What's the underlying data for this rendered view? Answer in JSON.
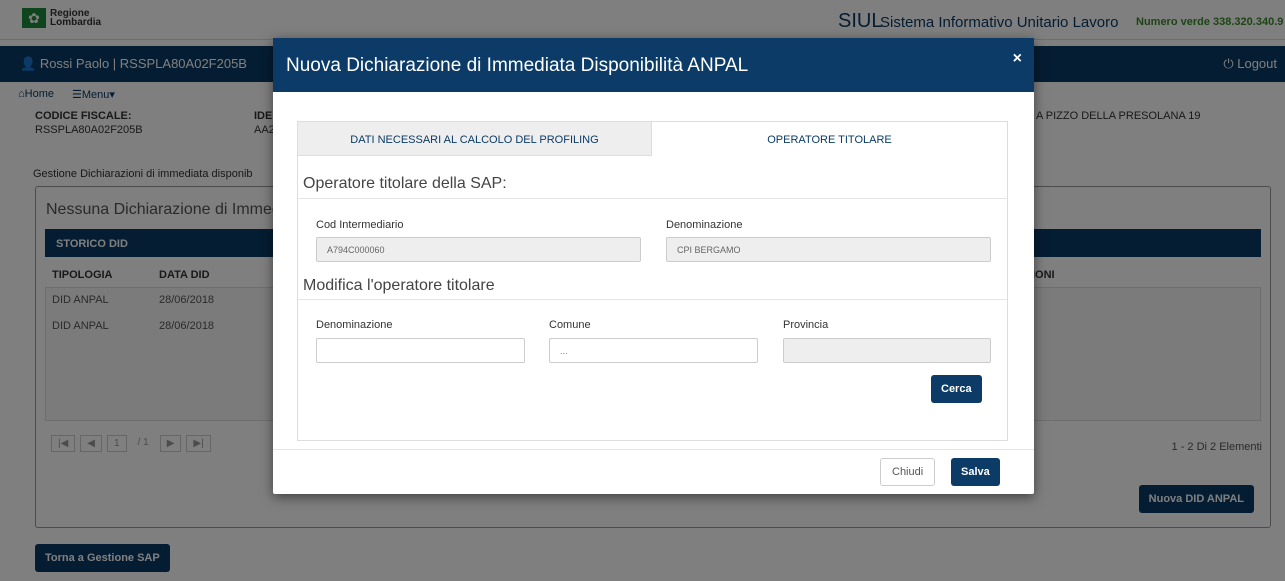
{
  "brand": {
    "logo_line1": "Regione",
    "logo_line2": "Lombardia",
    "siul": "SIUL",
    "siul_sub": "Sistema Informativo Unitario Lavoro",
    "numero_verde": "Numero verde 338.320.340.9"
  },
  "userbar": {
    "user": "Rossi Paolo | RSSPLA80A02F205B",
    "logout": "Logout"
  },
  "nav": {
    "home": "Home",
    "menu": "Menu"
  },
  "anagrafica": {
    "cf_label": "CODICE FISCALE:",
    "cf_value": "RSSPLA80A02F205B",
    "ide_label": "IDE",
    "ide_value": "AA2",
    "address": "A PIZZO DELLA PRESOLANA 19"
  },
  "page": {
    "gestione": "Gestione Dichiarazioni di immediata disponib",
    "panel_title": "Nessuna Dichiarazione di Immedi",
    "storico": "STORICO DID"
  },
  "table": {
    "headers": {
      "tipologia": "TIPOLOGIA",
      "data": "DATA DID",
      "azioni": "IONI"
    },
    "rows": [
      {
        "tipologia": "DID ANPAL",
        "data": "28/06/2018"
      },
      {
        "tipologia": "DID ANPAL",
        "data": "28/06/2018"
      }
    ],
    "pager_page": "1",
    "pager_of": "/ 1",
    "elementi": "1 - 2 Di 2 Elementi"
  },
  "buttons": {
    "nuova_did": "Nuova DID ANPAL",
    "torna": "Torna a Gestione SAP"
  },
  "modal": {
    "title": "Nuova Dichiarazione di Immediata Disponibilità ANPAL",
    "close": "×",
    "tabs": [
      {
        "label": "DATI NECESSARI AL CALCOLO DEL PROFILING"
      },
      {
        "label": "OPERATORE TITOLARE"
      }
    ],
    "section1": {
      "title": "Operatore titolare della SAP:",
      "cod_label": "Cod Intermediario",
      "cod_value": "A794C000060",
      "den_label": "Denominazione",
      "den_value": "CPI BERGAMO"
    },
    "section2": {
      "title": "Modifica l'operatore titolare",
      "den_label": "Denominazione",
      "den_value": "",
      "comune_label": "Comune",
      "comune_placeholder": "...",
      "provincia_label": "Provincia",
      "provincia_value": "",
      "cerca": "Cerca"
    },
    "footer": {
      "chiudi": "Chiudi",
      "salva": "Salva"
    }
  }
}
